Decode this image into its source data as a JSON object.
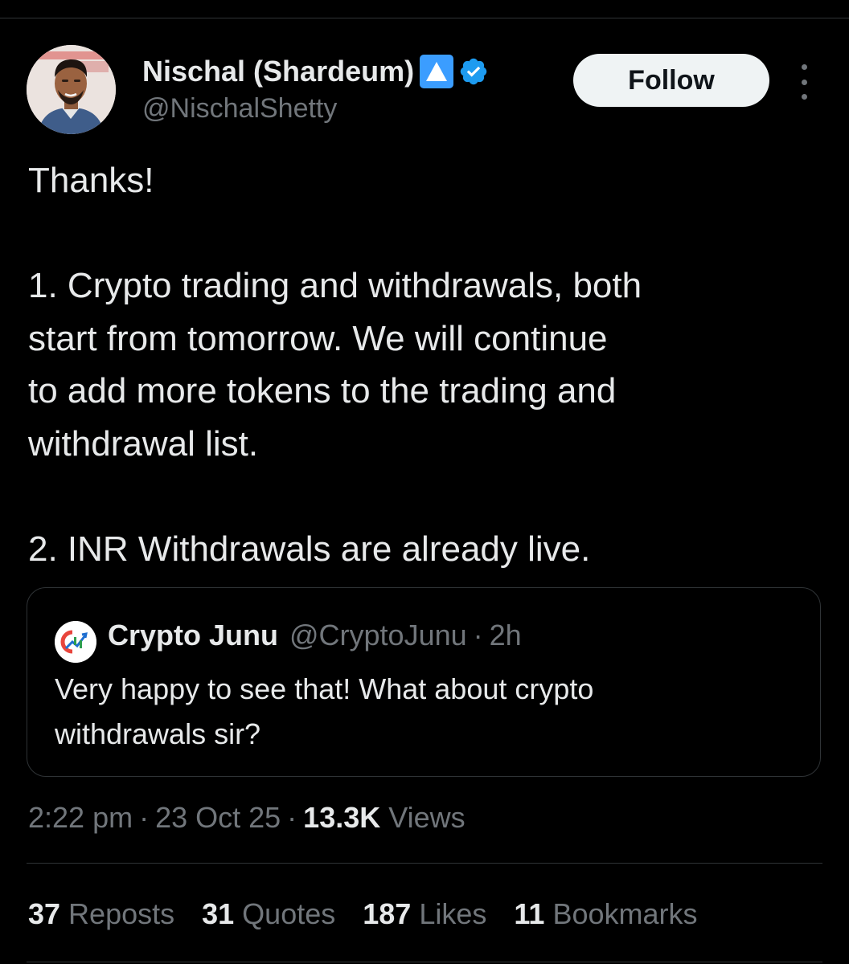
{
  "author": {
    "display_name": "Nischal (Shardeum)",
    "handle": "@NischalShetty",
    "avatar_icon": "profile-photo",
    "badges": [
      "up-arrow-emoji-icon",
      "verified-icon"
    ],
    "badge_colors": {
      "arrow": "#3b9dff",
      "verified": "#1d9bf0"
    }
  },
  "follow_label": "Follow",
  "tweet_lines": [
    "Thanks!",
    "",
    "1. Crypto trading and withdrawals, both",
    "start from tomorrow. We will continue",
    "to add more tokens to the trading and",
    "withdrawal list.",
    "",
    "2. INR Withdrawals are already live."
  ],
  "quote": {
    "name": "Crypto Junu",
    "handle": "@CryptoJunu",
    "separator": "·",
    "time": "2h",
    "text_lines": [
      "Very happy to see that! What about crypto",
      "withdrawals sir?"
    ]
  },
  "meta": {
    "time": "2:22 pm",
    "separator": "·",
    "date": "23 Oct 25",
    "views_count": "13.3K",
    "views_label": "Views"
  },
  "stats": [
    {
      "count": "37",
      "label": "Reposts"
    },
    {
      "count": "31",
      "label": "Quotes"
    },
    {
      "count": "187",
      "label": "Likes"
    },
    {
      "count": "11",
      "label": "Bookmarks"
    }
  ],
  "colors": {
    "background": "#000000",
    "primary_text": "#e7e9ea",
    "secondary_text": "#71767b",
    "divider": "#2f3336",
    "follow_bg": "#eff3f4"
  }
}
